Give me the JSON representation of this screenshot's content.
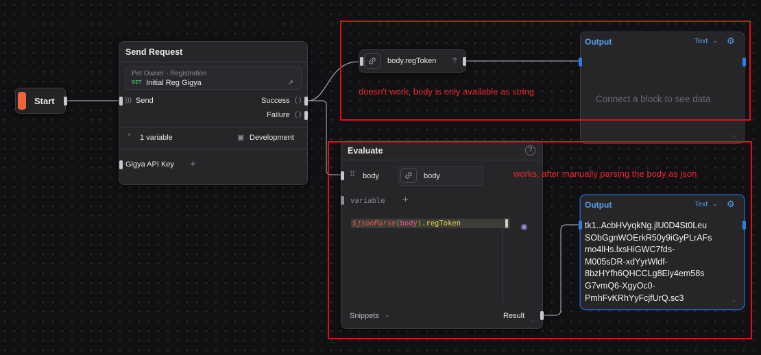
{
  "start": {
    "label": "Start"
  },
  "send_request": {
    "title": "Send Request",
    "request_group": "Pet Owner - Registration",
    "method": "GET",
    "request_name": "Initial Reg Gigya",
    "send_label": "Send",
    "success_label": "Success",
    "failure_label": "Failure",
    "variables_label": "1 variable",
    "environment_label": "Development",
    "variable_name": "Gigya API Key",
    "add_symbol": "+"
  },
  "regtoken_node": {
    "label": "body.regToken",
    "help": "?"
  },
  "output_top": {
    "title": "Output",
    "format": "Text",
    "placeholder": "Connect a block to see data"
  },
  "evaluate": {
    "title": "Evaluate",
    "input_name": "body",
    "input_value": "body",
    "variable_placeholder": "variable",
    "add_symbol": "+",
    "code_fn": "$jsonParse",
    "code_open": "(",
    "code_arg": "body",
    "code_close": ")",
    "code_prop": ".regToken",
    "snippets_label": "Snippets",
    "result_label": "Result"
  },
  "output_bottom": {
    "title": "Output",
    "format": "Text",
    "lines": [
      "tk1..AcbHVyqkNg.jlU0D4St0Leu",
      "SObGgnWOErkR50y9iGyPLrAFs",
      "mo4lHs.lxsHiGWC7fds-",
      "M005sDR-xdYyrWldf-",
      "8bzHYfh6QHCCLg8Ely4em58s",
      "G7vmQ6-XgyOc0-",
      "PmhFvKRhYyFcjfUrQ.sc3"
    ]
  },
  "annotations": {
    "top": "doesn't work, body is only available as string",
    "bottom": "works, after manually parsing the body as json"
  },
  "colors": {
    "accent_start": "#f0643c",
    "annotation_red": "#e0101a",
    "output_blue": "#5aa0f0"
  }
}
